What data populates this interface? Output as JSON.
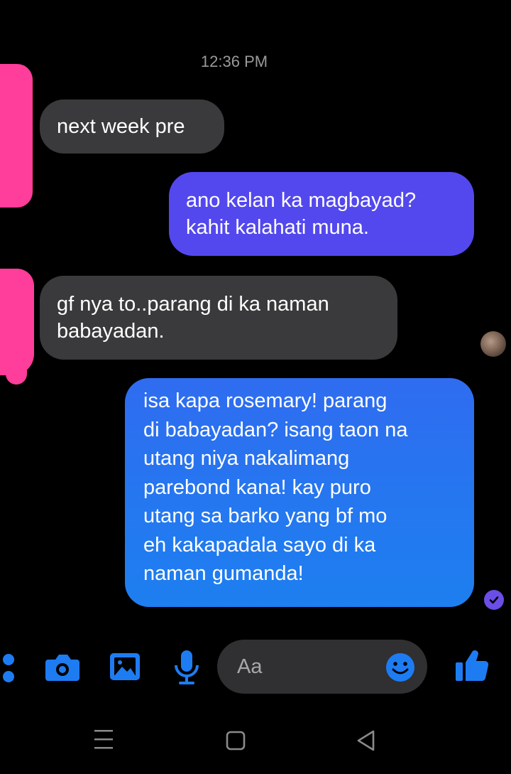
{
  "chat": {
    "timestamp": "12:36 PM",
    "messages": [
      {
        "direction": "incoming",
        "text": "next week pre"
      },
      {
        "direction": "outgoing",
        "text": "ano kelan ka magbayad?\nkahit kalahati muna."
      },
      {
        "direction": "incoming",
        "text": "gf nya to..parang di ka naman\nbabayadan."
      },
      {
        "direction": "outgoing",
        "text": "isa kapa rosemary! parang\ndi babayadan? isang taon na\nutang niya nakalimang\nparebond kana! kay puro\nutang sa barko yang bf mo\neh kakapadala sayo di ka\nnaman gumanda!"
      }
    ]
  },
  "composer": {
    "placeholder": "Aa",
    "icons": [
      "more-icon",
      "camera-icon",
      "gallery-icon",
      "microphone-icon",
      "emoji-icon",
      "thumbs-up-icon"
    ]
  },
  "navigation": {
    "icons": [
      "recents-icon",
      "home-icon",
      "back-icon"
    ]
  },
  "colors": {
    "background": "#000000",
    "incoming_bubble": "#3a3a3c",
    "outgoing_gradient_top": "#5b4df2",
    "outgoing_gradient_bottom": "#1f7ff0",
    "accent": "#1e7cf2",
    "redaction": "#ff3d9a"
  }
}
